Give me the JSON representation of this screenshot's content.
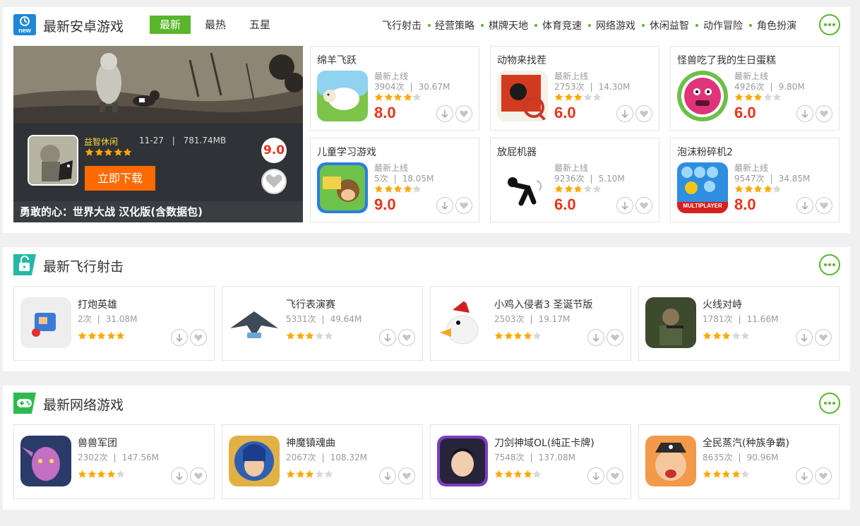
{
  "sections": {
    "latest": {
      "title": "最新安卓游戏",
      "icon": "new-badge-icon",
      "tabs": [
        "最新",
        "最热",
        "五星"
      ],
      "categories": [
        "飞行射击",
        "经营策略",
        "棋牌天地",
        "体育竞速",
        "网络游戏",
        "休闲益智",
        "动作冒险",
        "角色扮演"
      ],
      "featured": {
        "category": "益智休闲",
        "date": "11-27",
        "size": "781.74MB",
        "rating": 5,
        "score": "9.0",
        "download_label": "立即下载",
        "name": "勇敢的心：世界大战 汉化版(含数据包)"
      },
      "cards": [
        {
          "title": "绵羊飞跃",
          "sub": "最新上线",
          "count": "3904次",
          "size": "30.67M",
          "rating": 4,
          "score": "8.0",
          "icon": "sheep-icon"
        },
        {
          "title": "动物来找茬",
          "sub": "最新上线",
          "count": "2753次",
          "size": "14.30M",
          "rating": 3,
          "score": "6.0",
          "icon": "magnifier-icon"
        },
        {
          "title": "怪兽吃了我的生日蛋糕",
          "sub": "最新上线",
          "count": "4926次",
          "size": "9.80M",
          "rating": 3,
          "score": "6.0",
          "icon": "monster-icon"
        },
        {
          "title": "儿童学习游戏",
          "sub": "最新上线",
          "count": "5次",
          "size": "18.05M",
          "rating": 4,
          "score": "9.0",
          "icon": "monkey-icon"
        },
        {
          "title": "放屁机器",
          "sub": "最新上线",
          "count": "9236次",
          "size": "5.10M",
          "rating": 3,
          "score": "6.0",
          "icon": "figure-icon"
        },
        {
          "title": "泡沫粉碎机2",
          "sub": "最新上线",
          "count": "9547次",
          "size": "34.85M",
          "rating": 4,
          "score": "8.0",
          "icon": "bubbles-icon",
          "badge": "MULTIPLAYER"
        }
      ]
    },
    "shooting": {
      "title": "最新飞行射击",
      "icon": "lock-icon",
      "cards": [
        {
          "title": "打炮英雄",
          "count": "2次",
          "size": "31.08M",
          "rating": 5,
          "icon": "cannon-icon"
        },
        {
          "title": "飞行表演赛",
          "count": "5331次",
          "size": "49.64M",
          "rating": 3,
          "icon": "jet-icon"
        },
        {
          "title": "小鸡入侵者3 圣诞节版",
          "count": "2503次",
          "size": "19.17M",
          "rating": 4,
          "icon": "chicken-icon"
        },
        {
          "title": "火线对峙",
          "count": "1781次",
          "size": "11.66M",
          "rating": 3,
          "icon": "soldier-icon"
        }
      ]
    },
    "online": {
      "title": "最新网络游戏",
      "icon": "gamepad-icon",
      "cards": [
        {
          "title": "兽兽军团",
          "count": "2302次",
          "size": "147.56M",
          "rating": 4,
          "icon": "elf-icon"
        },
        {
          "title": "神魔镇魂曲",
          "count": "2067次",
          "size": "108.32M",
          "rating": 3,
          "icon": "sorceress-icon"
        },
        {
          "title": "刀剑神域OL(纯正卡牌)",
          "count": "7548次",
          "size": "137.08M",
          "rating": 4,
          "icon": "swordsman-icon"
        },
        {
          "title": "全民蒸汽(种族争霸)",
          "count": "8635次",
          "size": "90.96M",
          "rating": 4,
          "icon": "pirate-icon"
        }
      ]
    }
  },
  "colors": {
    "accent": "#5ab62a",
    "score": "#e8331c",
    "download": "#ff6a00",
    "star": "#ffa800",
    "star_empty": "#d8d8d8"
  }
}
